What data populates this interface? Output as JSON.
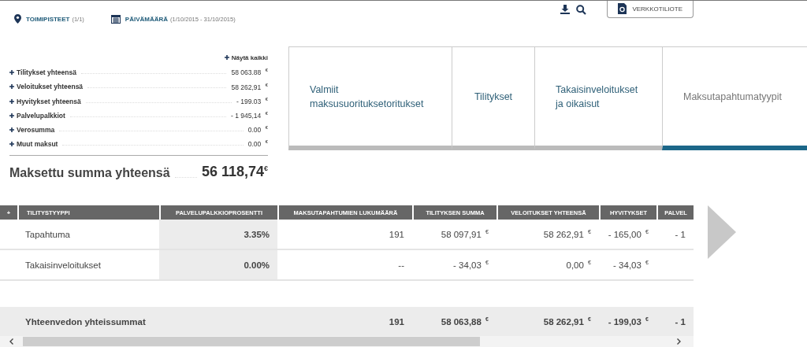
{
  "filters": [
    {
      "kind": "location",
      "label": "TOIMIPISTEET",
      "detail": "(1/1)"
    },
    {
      "kind": "date",
      "label": "PÄIVÄMÄÄRÄ",
      "detail": "(1/10/2015 - 31/10/2015)"
    }
  ],
  "toolbar": {
    "statement_button": "VERKKOTILIOTE"
  },
  "summary": {
    "show_all": "Näytä kaikki",
    "rows": [
      {
        "label": "Tilitykset yhteensä",
        "value": "58 063.88 $^{€}$"
      },
      {
        "label": "Veloitukset yhteensä",
        "value": "58 262,91 $^{€}$"
      },
      {
        "label": "Hyvitykset yhteensä",
        "value": "- 199.03 $^{€}$"
      },
      {
        "label": "Palvelupalkkiot",
        "value": "- 1 945,14 $^{€}$"
      },
      {
        "label": "Verosumma",
        "value": "0.00 $^{€}$"
      },
      {
        "label": "Muut maksut",
        "value": "0.00 $^{€}$"
      }
    ],
    "total_label": "Maksettu summa yhteensä",
    "total_value": "56 118,74$^{€}$"
  },
  "tabs": [
    {
      "label": "Valmiit maksusuorituksetoritukset",
      "selected": false
    },
    {
      "label": "Tilitykset",
      "selected": false
    },
    {
      "label": "Takaisinveloitukset ja oikaisut",
      "selected": false
    },
    {
      "label": "Maksutapahtumatyypit",
      "selected": true
    }
  ],
  "table": {
    "expand": "+",
    "columns": [
      "TILITYSTYYPPI",
      "PALVELUPALKKIOPROSENTTI",
      "MAKSUTAPAHTUMIEN LUKUMÄÄRÄ",
      "TILITYKSEN SUMMA",
      "VELOITUKSET YHTEENSÄ",
      "HYVITYKSET",
      "PALVEL"
    ],
    "rows": [
      [
        "Tapahtuma",
        "3.35%",
        "191",
        "58 097,91 $^{€}$",
        "58 262,91 $^{€}$",
        "- 165,00 $^{€}$",
        "- 1"
      ],
      [
        "Takaisinveloitukset",
        "0.00%",
        "--",
        "- 34,03 $^{€}$",
        "0,00 $^{€}$",
        "- 34,03 $^{€}$",
        ""
      ]
    ],
    "totals": {
      "label": "Yhteenvedon yhteissummat",
      "values": [
        "191",
        "58 063,88 $^{€}$",
        "58 262,91 $^{€}$",
        "- 199,03 $^{€}$",
        "- 1"
      ]
    }
  }
}
